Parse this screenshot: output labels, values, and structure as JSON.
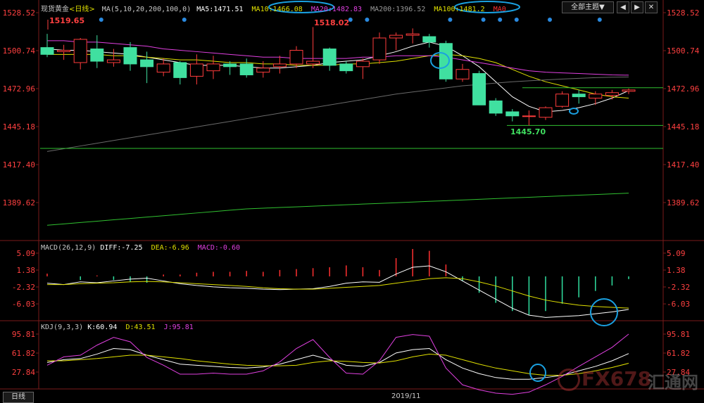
{
  "header": {
    "instrument": "现货黄金",
    "period_tag": "<日线>",
    "ma_spec": "MA(5,10,20,200,100,0)",
    "ma5": "MA5:1471.51",
    "ma10": "MA10:1466.08",
    "ma20": "MA20:1482.83",
    "ma200": "MA200:1396.52",
    "ma100": "MA100:1481.2",
    "ma0": "MA0",
    "theme_button": "全部主题▼",
    "colors": {
      "ma5": "#ffffff",
      "ma10": "#e0e000",
      "ma20": "#e040e0",
      "ma200": "#6a6a6a",
      "ma100": "#e0e000",
      "ma0": "#ff3030",
      "label": "#c8c8c8",
      "price": "#ff4040"
    }
  },
  "macd_header": {
    "spec": "MACD(26,12,9)",
    "diff": "DIFF:-7.25",
    "dea": "DEA:-6.96",
    "macd": "MACD:-0.60"
  },
  "kdj_header": {
    "spec": "KDJ(9,3,3)",
    "k": "K:60.94",
    "d": "D:43.51",
    "j": "J:95.81"
  },
  "footer": {
    "period_button": "日线",
    "date_label": "2019/11"
  },
  "watermark": {
    "brand": "FX678",
    "cn": "汇通网"
  },
  "chart_data": [
    {
      "type": "candlestick",
      "title": "现货黄金 <日线>",
      "y_ticks": [
        "1528.52",
        "1500.74",
        "1472.96",
        "1445.18",
        "1417.40",
        "1389.62"
      ],
      "ylim": [
        1373,
        1532
      ],
      "annotations": {
        "high_1": "1519.65",
        "high_2": "1518.02",
        "low_1": "1445.70",
        "hline_1": 1473.6,
        "hline_2": 1446.0
      },
      "candles": [
        {
          "o": 1503,
          "c": 1498,
          "h": 1513,
          "l": 1496
        },
        {
          "o": 1500,
          "c": 1501,
          "h": 1505,
          "l": 1494
        },
        {
          "o": 1492,
          "c": 1509,
          "h": 1510,
          "l": 1487
        },
        {
          "o": 1502,
          "c": 1493,
          "h": 1512,
          "l": 1488
        },
        {
          "o": 1492,
          "c": 1494,
          "h": 1502,
          "l": 1489
        },
        {
          "o": 1503,
          "c": 1491,
          "h": 1507,
          "l": 1486
        },
        {
          "o": 1494,
          "c": 1489,
          "h": 1500,
          "l": 1477
        },
        {
          "o": 1485,
          "c": 1491,
          "h": 1495,
          "l": 1482
        },
        {
          "o": 1492,
          "c": 1481,
          "h": 1493,
          "l": 1476
        },
        {
          "o": 1482,
          "c": 1491,
          "h": 1498,
          "l": 1476
        },
        {
          "o": 1486,
          "c": 1491,
          "h": 1497,
          "l": 1480
        },
        {
          "o": 1491,
          "c": 1489,
          "h": 1493,
          "l": 1483
        },
        {
          "o": 1491,
          "c": 1483,
          "h": 1495,
          "l": 1481
        },
        {
          "o": 1485,
          "c": 1488,
          "h": 1493,
          "l": 1481
        },
        {
          "o": 1489,
          "c": 1491,
          "h": 1497,
          "l": 1484
        },
        {
          "o": 1491,
          "c": 1501,
          "h": 1504,
          "l": 1488
        },
        {
          "o": 1491,
          "c": 1493,
          "h": 1518,
          "l": 1488
        },
        {
          "o": 1502,
          "c": 1490,
          "h": 1503,
          "l": 1486
        },
        {
          "o": 1491,
          "c": 1486,
          "h": 1493,
          "l": 1484
        },
        {
          "o": 1489,
          "c": 1493,
          "h": 1495,
          "l": 1480
        },
        {
          "o": 1494,
          "c": 1510,
          "h": 1514,
          "l": 1491
        },
        {
          "o": 1510,
          "c": 1512,
          "h": 1514,
          "l": 1501
        },
        {
          "o": 1512,
          "c": 1513,
          "h": 1517,
          "l": 1506
        },
        {
          "o": 1511,
          "c": 1507,
          "h": 1513,
          "l": 1503
        },
        {
          "o": 1506,
          "c": 1480,
          "h": 1508,
          "l": 1478
        },
        {
          "o": 1480,
          "c": 1487,
          "h": 1491,
          "l": 1478
        },
        {
          "o": 1484,
          "c": 1461,
          "h": 1486,
          "l": 1461
        },
        {
          "o": 1464,
          "c": 1455,
          "h": 1466,
          "l": 1453
        },
        {
          "o": 1456,
          "c": 1453,
          "h": 1458,
          "l": 1449
        },
        {
          "o": 1453,
          "c": 1453,
          "h": 1457,
          "l": 1446
        },
        {
          "o": 1452,
          "c": 1459,
          "h": 1460,
          "l": 1450
        },
        {
          "o": 1460,
          "c": 1469,
          "h": 1471,
          "l": 1459
        },
        {
          "o": 1469,
          "c": 1467,
          "h": 1472,
          "l": 1462
        },
        {
          "o": 1466,
          "c": 1469,
          "h": 1471,
          "l": 1461
        },
        {
          "o": 1468,
          "c": 1470,
          "h": 1472,
          "l": 1465
        },
        {
          "o": 1471,
          "c": 1472,
          "h": 1473,
          "l": 1469
        }
      ],
      "series": [
        {
          "name": "MA5",
          "color": "#ffffff",
          "values": [
            1502,
            1501,
            1501,
            1500,
            1499,
            1498,
            1496,
            1494,
            1492,
            1490,
            1490,
            1490,
            1489,
            1488,
            1488,
            1489,
            1490,
            1492,
            1493,
            1494,
            1497,
            1500,
            1504,
            1507,
            1504,
            1497,
            1489,
            1478,
            1467,
            1460,
            1456,
            1457,
            1459,
            1462,
            1466,
            1471.5
          ]
        },
        {
          "name": "MA10",
          "color": "#e0e000",
          "values": [
            1498,
            1498,
            1498,
            1498,
            1497,
            1497,
            1496,
            1495,
            1494,
            1494,
            1493,
            1492,
            1492,
            1491,
            1491,
            1490,
            1490,
            1490,
            1491,
            1491,
            1492,
            1493,
            1495,
            1497,
            1498,
            1497,
            1495,
            1492,
            1487,
            1482,
            1478,
            1475,
            1472,
            1469,
            1467,
            1466
          ]
        },
        {
          "name": "MA20",
          "color": "#e040e0",
          "values": [
            1508,
            1508,
            1507,
            1507,
            1506,
            1505,
            1504,
            1502,
            1501,
            1500,
            1499,
            1498,
            1497,
            1496,
            1496,
            1495,
            1495,
            1495,
            1495,
            1496,
            1496,
            1497,
            1497,
            1497,
            1496,
            1494,
            1492,
            1490,
            1488,
            1486,
            1485,
            1484.5,
            1484,
            1483.5,
            1483,
            1482.8
          ]
        },
        {
          "name": "MA100",
          "color": "#e0e000",
          "values": [
            1473.6
          ]
        },
        {
          "name": "MA200",
          "color": "#6a6a6a",
          "values": [
            1427,
            1429,
            1431,
            1433,
            1435,
            1437,
            1439,
            1441,
            1443,
            1445,
            1447,
            1449,
            1451,
            1453,
            1455,
            1457,
            1459,
            1461,
            1463,
            1465,
            1467,
            1469,
            1470.5,
            1472,
            1473.5,
            1475,
            1476,
            1477,
            1478,
            1478.7,
            1479.3,
            1480,
            1480.5,
            1481,
            1481.3,
            1481.5
          ]
        },
        {
          "name": "MA0",
          "color": "#30c030",
          "values": [
            1373,
            1374,
            1375,
            1376,
            1377,
            1378,
            1379,
            1380,
            1381,
            1382,
            1383,
            1384,
            1385,
            1385.5,
            1386,
            1386.5,
            1387,
            1387.5,
            1388,
            1388.5,
            1389,
            1389.5,
            1390,
            1390.5,
            1391,
            1391.5,
            1392,
            1392.5,
            1393,
            1393.5,
            1394,
            1394.5,
            1395,
            1395.5,
            1396,
            1396.5
          ]
        }
      ]
    },
    {
      "type": "bar",
      "title": "MACD(26,12,9)",
      "y_ticks": [
        "5.09",
        "1.38",
        "-2.32",
        "-6.03"
      ],
      "ylim": [
        -10,
        6
      ],
      "series": [
        {
          "name": "DIFF",
          "color": "#ffffff",
          "values": [
            -1.5,
            -1.8,
            -1.2,
            -1.4,
            -1.0,
            -0.6,
            -0.4,
            -1.0,
            -1.6,
            -2.0,
            -2.3,
            -2.5,
            -2.6,
            -2.8,
            -2.9,
            -2.8,
            -2.7,
            -2.2,
            -1.5,
            -1.2,
            -1.3,
            0.5,
            2.0,
            2.3,
            1.0,
            -1.0,
            -3.0,
            -5.0,
            -7.0,
            -8.5,
            -9.0,
            -8.8,
            -8.6,
            -8.2,
            -7.8,
            -7.25
          ]
        },
        {
          "name": "DEA",
          "color": "#e0e000",
          "values": [
            -1.8,
            -1.8,
            -1.6,
            -1.5,
            -1.4,
            -1.2,
            -1.1,
            -1.2,
            -1.4,
            -1.6,
            -1.8,
            -2.0,
            -2.2,
            -2.5,
            -2.7,
            -2.8,
            -2.8,
            -2.6,
            -2.4,
            -2.2,
            -2.0,
            -1.5,
            -1.0,
            -0.5,
            -0.3,
            -0.5,
            -1.2,
            -2.1,
            -3.2,
            -4.3,
            -5.2,
            -5.8,
            -6.3,
            -6.6,
            -6.8,
            -6.96
          ]
        },
        {
          "name": "MACD",
          "color": "#ff3030",
          "values": [
            0.6,
            0.0,
            -0.8,
            0.2,
            -0.8,
            -1.2,
            -1.4,
            0.4,
            0.4,
            0.8,
            1.0,
            1.0,
            1.2,
            1.0,
            1.4,
            1.6,
            1.8,
            2.0,
            2.4,
            2.0,
            1.4,
            4.0,
            6.0,
            5.6,
            2.6,
            -1.0,
            -3.6,
            -5.8,
            -7.6,
            -8.4,
            -7.6,
            -6.0,
            -4.6,
            -3.2,
            -2.0,
            -0.6
          ]
        }
      ]
    },
    {
      "type": "line",
      "title": "KDJ(9,3,3)",
      "y_ticks": [
        "95.81",
        "61.82",
        "27.84"
      ],
      "ylim": [
        -5,
        110
      ],
      "series": [
        {
          "name": "K",
          "color": "#ffffff",
          "values": [
            45,
            50,
            52,
            60,
            70,
            68,
            58,
            50,
            42,
            40,
            38,
            36,
            35,
            37,
            42,
            50,
            58,
            50,
            40,
            38,
            45,
            62,
            68,
            70,
            50,
            35,
            25,
            18,
            15,
            15,
            18,
            22,
            30,
            38,
            48,
            60.94
          ]
        },
        {
          "name": "D",
          "color": "#e0e000",
          "values": [
            48,
            48,
            50,
            52,
            55,
            58,
            58,
            55,
            52,
            48,
            45,
            42,
            40,
            39,
            39,
            40,
            45,
            48,
            47,
            45,
            44,
            48,
            55,
            60,
            58,
            50,
            42,
            35,
            30,
            25,
            22,
            22,
            25,
            30,
            36,
            43.51
          ]
        },
        {
          "name": "J",
          "color": "#e040e0",
          "values": [
            40,
            55,
            58,
            76,
            90,
            82,
            54,
            40,
            24,
            24,
            26,
            24,
            24,
            30,
            46,
            70,
            86,
            54,
            26,
            24,
            48,
            90,
            95,
            92,
            35,
            5,
            -4,
            -10,
            -12,
            -8,
            5,
            20,
            38,
            55,
            72,
            95.81
          ]
        }
      ]
    }
  ]
}
